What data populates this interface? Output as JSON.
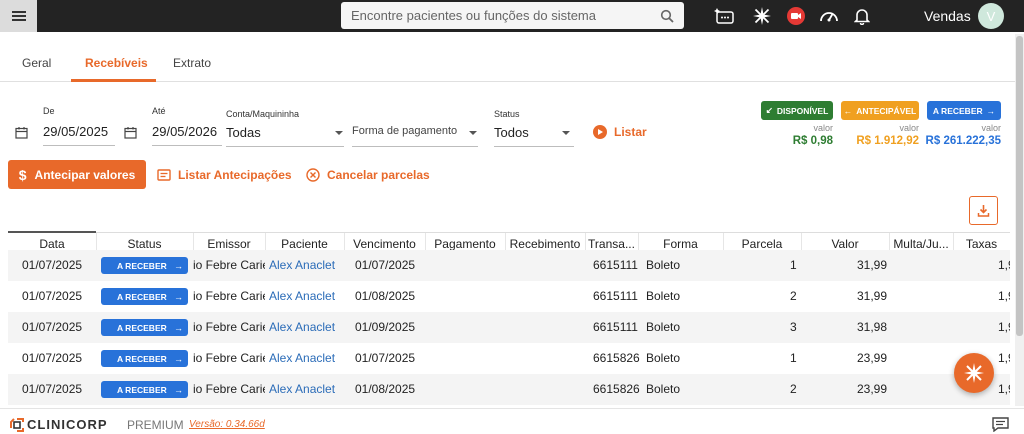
{
  "header": {
    "search_placeholder": "Encontre pacientes ou funções do sistema",
    "user_name": "Vendas",
    "avatar_initial": "V"
  },
  "tabs": [
    {
      "label": "Geral",
      "active": false
    },
    {
      "label": "Recebíveis",
      "active": true
    },
    {
      "label": "Extrato",
      "active": false
    }
  ],
  "filters": {
    "de_label": "De",
    "de_value": "29/05/2025",
    "ate_label": "Até",
    "ate_value": "29/05/2026",
    "conta_label": "Conta/Maquininha",
    "conta_value": "Todas",
    "forma_placeholder": "Forma de pagamento",
    "status_label": "Status",
    "status_value": "Todos",
    "listar_label": "Listar"
  },
  "summary": {
    "disponivel": {
      "badge": "DISPONÍVEL",
      "label": "valor",
      "value": "R$ 0,98",
      "color": "#2e7d32"
    },
    "antecipavel": {
      "badge": "ANTECIPÁVEL",
      "label": "valor",
      "value": "R$ 1.912,92",
      "color": "#f0a020"
    },
    "a_receber": {
      "badge": "A RECEBER",
      "label": "valor",
      "value": "R$ 261.222,35",
      "color": "#2872d9"
    }
  },
  "actions": {
    "antecipar": "Antecipar valores",
    "listar_antecipacoes": "Listar Antecipações",
    "cancelar_parcelas": "Cancelar parcelas"
  },
  "table": {
    "columns": [
      "Data",
      "Status",
      "Emissor",
      "Paciente",
      "Vencimento",
      "Pagamento",
      "Recebimento",
      "Transa...",
      "Forma",
      "Parcela",
      "Valor",
      "Multa/Ju...",
      "Taxas"
    ],
    "rows": [
      {
        "data": "01/07/2025",
        "status": "A RECEBER",
        "emissor": "io Febre Carie",
        "paciente": "Alex Anaclet",
        "vencimento": "01/07/2025",
        "transacao": "6615111",
        "forma": "Boleto",
        "parcela": "1",
        "valor": "31,99",
        "taxas": "1,9"
      },
      {
        "data": "01/07/2025",
        "status": "A RECEBER",
        "emissor": "io Febre Carie",
        "paciente": "Alex Anaclet",
        "vencimento": "01/08/2025",
        "transacao": "6615111",
        "forma": "Boleto",
        "parcela": "2",
        "valor": "31,99",
        "taxas": "1,9"
      },
      {
        "data": "01/07/2025",
        "status": "A RECEBER",
        "emissor": "io Febre Carie",
        "paciente": "Alex Anaclet",
        "vencimento": "01/09/2025",
        "transacao": "6615111",
        "forma": "Boleto",
        "parcela": "3",
        "valor": "31,98",
        "taxas": "1,9"
      },
      {
        "data": "01/07/2025",
        "status": "A RECEBER",
        "emissor": "io Febre Carie",
        "paciente": "Alex Anaclet",
        "vencimento": "01/07/2025",
        "transacao": "6615826",
        "forma": "Boleto",
        "parcela": "1",
        "valor": "23,99",
        "taxas": "1,9"
      },
      {
        "data": "01/07/2025",
        "status": "A RECEBER",
        "emissor": "io Febre Carie",
        "paciente": "Alex Anaclet",
        "vencimento": "01/08/2025",
        "transacao": "6615826",
        "forma": "Boleto",
        "parcela": "2",
        "valor": "23,99",
        "taxas": "1,9"
      }
    ]
  },
  "footer": {
    "brand": "CLINICORP",
    "plan": "PREMIUM",
    "version": "Versão: 0.34.66d"
  },
  "colors": {
    "accent": "#e8692a",
    "link": "#2b6cb8",
    "badge_blue": "#2872d9"
  }
}
